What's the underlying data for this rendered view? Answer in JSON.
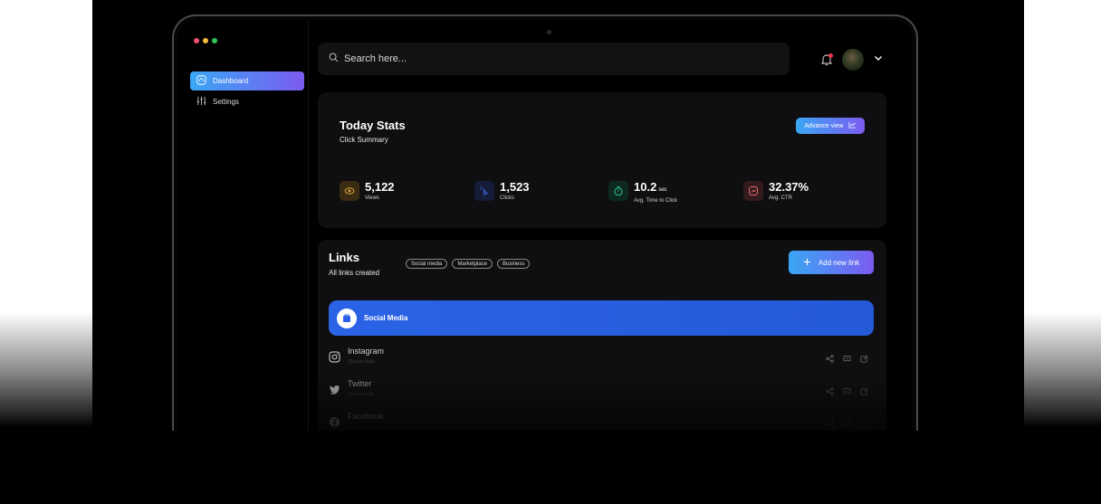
{
  "window_dots": [
    "#f0506e",
    "#f4b740",
    "#35c45a"
  ],
  "sidebar": {
    "items": [
      {
        "label": "Dashboard",
        "icon": "dashboard-icon",
        "active": true
      },
      {
        "label": "Settings",
        "icon": "sliders-icon",
        "active": false
      }
    ]
  },
  "search": {
    "placeholder": "Search here..."
  },
  "header": {
    "notification_icon": "bell-icon",
    "avatar": "user-avatar",
    "menu_icon": "chevron-down-icon"
  },
  "stats": {
    "title": "Today Stats",
    "subtitle": "Click Summary",
    "advance_label": "Advance view",
    "items": [
      {
        "value": "5,122",
        "unit": "",
        "label": "Views",
        "icon": "eye-icon",
        "color": "#d8a53a",
        "bg": "#3a2c12"
      },
      {
        "value": "1,523",
        "unit": "",
        "label": "Clicks",
        "icon": "cursor-click-icon",
        "color": "#3b67e0",
        "bg": "#141c38"
      },
      {
        "value": "10.2",
        "unit": "sec",
        "label": "Avg. Time to Click",
        "icon": "timer-icon",
        "color": "#2fc08a",
        "bg": "#0e2a20"
      },
      {
        "value": "32.37%",
        "unit": "",
        "label": "Avg. CTR",
        "icon": "ctr-icon",
        "color": "#e26a73",
        "bg": "#341a1c"
      }
    ]
  },
  "links": {
    "title": "Links",
    "subtitle": "All links created",
    "tags": [
      "Social media",
      "Marketplace",
      "Business"
    ],
    "add_label": "Add new link",
    "category": {
      "label": "Social Media"
    },
    "rows": [
      {
        "name": "Instagram",
        "handle": "@karen-daily",
        "icon": "instagram-icon"
      },
      {
        "name": "Twitter",
        "handle": "@karen-daily",
        "icon": "twitter-icon"
      },
      {
        "name": "Facebook",
        "handle": "",
        "icon": "facebook-icon"
      }
    ]
  }
}
